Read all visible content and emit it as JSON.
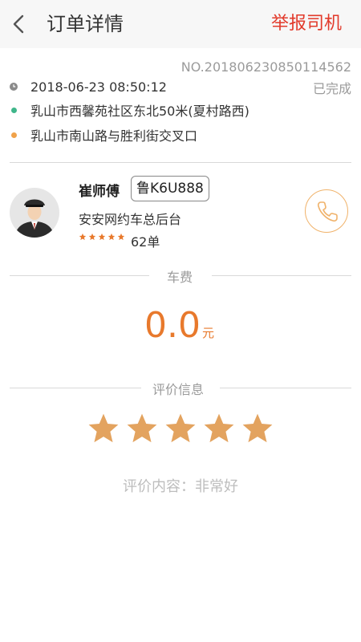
{
  "header": {
    "back_icon": "chevron-left-icon",
    "title": "订单详情",
    "report_label": "举报司机"
  },
  "order": {
    "order_no": "NO.20180623085011456​2",
    "status": "已完成",
    "time": "2018-06-23 08:50:12",
    "start": "乳山市西馨苑社区东北50米(夏村路西)",
    "end": "乳山市南山路与胜利街交叉口"
  },
  "driver": {
    "name": "崔师傅",
    "plate": "鲁K6U888",
    "company": "安安网约车总后台",
    "rating_stars": 5,
    "order_count": "62单",
    "phone_icon": "phone-icon"
  },
  "fee": {
    "section_label": "车费",
    "amount": "0.0",
    "unit": "元"
  },
  "rating": {
    "section_label": "评价信息",
    "stars": 5,
    "content": "评价内容：非常好"
  },
  "colors": {
    "accent_red": "#e23a2b",
    "accent_orange": "#e8792c",
    "star": "#e3a35f",
    "start_dot": "#3fb68a",
    "end_dot": "#f0a24a"
  }
}
